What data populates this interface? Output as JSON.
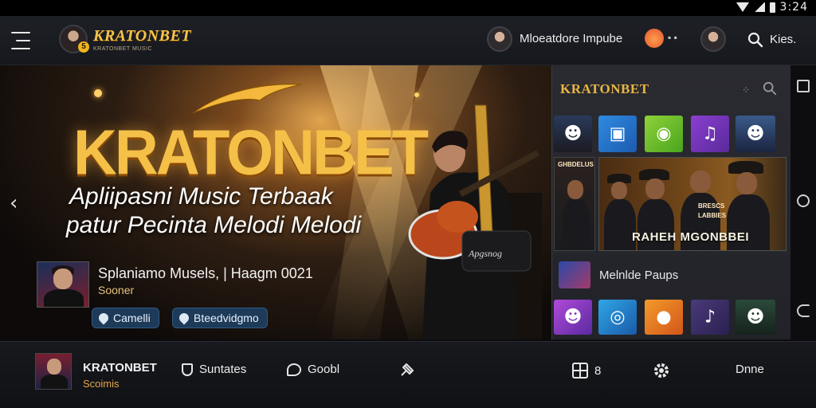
{
  "status_bar": {
    "time": "3:24"
  },
  "app_bar": {
    "brand": "KRATONBET",
    "brand_sub": "KRATONBET MUSIC",
    "badge": "5",
    "profile_name": "Mloeatdore Impube",
    "search_label": "Kies."
  },
  "hero": {
    "title": "KRATONBET",
    "subtitle_line1": "Apliipasni Music Terbaak",
    "subtitle_line2": "patur Pecinta Melodi Melodi",
    "guitar_label": "Apgsnog",
    "card_title": "Splaniamo Musels, | Haagm 0021",
    "card_sub": "Sooner",
    "pill_1": "Camelli",
    "pill_2": "Bteedvidgmo",
    "prev_glyph": "‹"
  },
  "side_panel": {
    "brand": "KRATONBET",
    "banner_caption": "RAHEH MGONBBEI",
    "banner_small_1": "GHBDELUS",
    "banner_small_2": "BRESCS",
    "banner_small_3": "LABBIES",
    "row_label": "Melnlde Paups"
  },
  "bottom_bar": {
    "now_playing_title": "KRATONBET",
    "now_playing_sub": "Scoimis",
    "nav_1": "Suntates",
    "nav_2": "Goobl",
    "nav_4": "8",
    "nav_6": "Dnne"
  },
  "colors": {
    "accent_gold": "#f5c048",
    "panel_bg": "#2a2b31",
    "pill_blue": "#1d3a58"
  }
}
